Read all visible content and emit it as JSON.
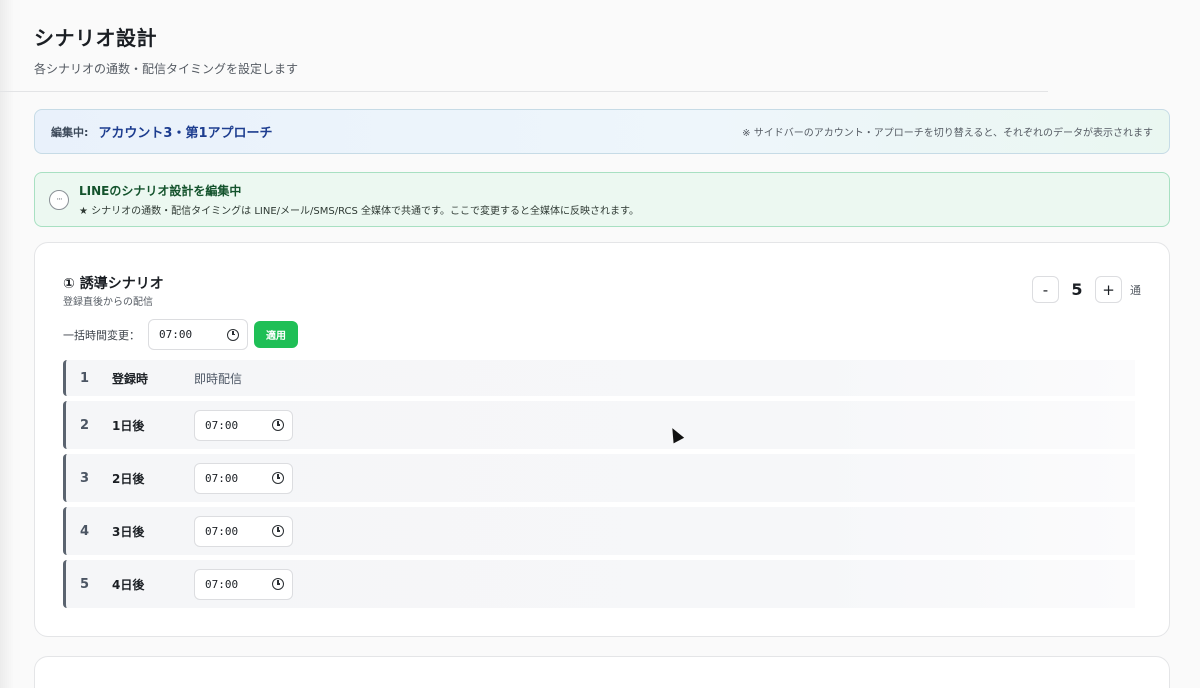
{
  "header": {
    "title": "シナリオ設計",
    "subtitle": "各シナリオの通数・配信タイミングを設定します"
  },
  "editing": {
    "label": "編集中:",
    "value": "アカウント3・第1アプローチ",
    "note": "※ サイドバーのアカウント・アプローチを切り替えると、それぞれのデータが表示されます"
  },
  "info": {
    "icon": "chat-bubble-icon",
    "icon_glyph": "···",
    "title": "LINEのシナリオ設計を編集中",
    "text": "★ シナリオの通数・配信タイミングは LINE/メール/SMS/RCS 全媒体で共通です。ここで変更すると全媒体に反映されます。"
  },
  "scenario": {
    "title": "① 誘導シナリオ",
    "subtitle": "登録直後からの配信",
    "count": {
      "minus": "-",
      "value": "5",
      "plus": "+",
      "unit": "通"
    },
    "bulk": {
      "label": "一括時間変更：",
      "time": "07:00",
      "apply_label": "適用"
    },
    "rows": [
      {
        "num": "1",
        "label": "登録時",
        "static": "即時配信"
      },
      {
        "num": "2",
        "label": "1日後",
        "time": "07:00"
      },
      {
        "num": "3",
        "label": "2日後",
        "time": "07:00"
      },
      {
        "num": "4",
        "label": "3日後",
        "time": "07:00"
      },
      {
        "num": "5",
        "label": "4日後",
        "time": "07:00"
      }
    ]
  },
  "colors": {
    "accent_green": "#1fbf56",
    "editing_value": "#1d3d8f",
    "info_border": "#a8e0c2"
  }
}
